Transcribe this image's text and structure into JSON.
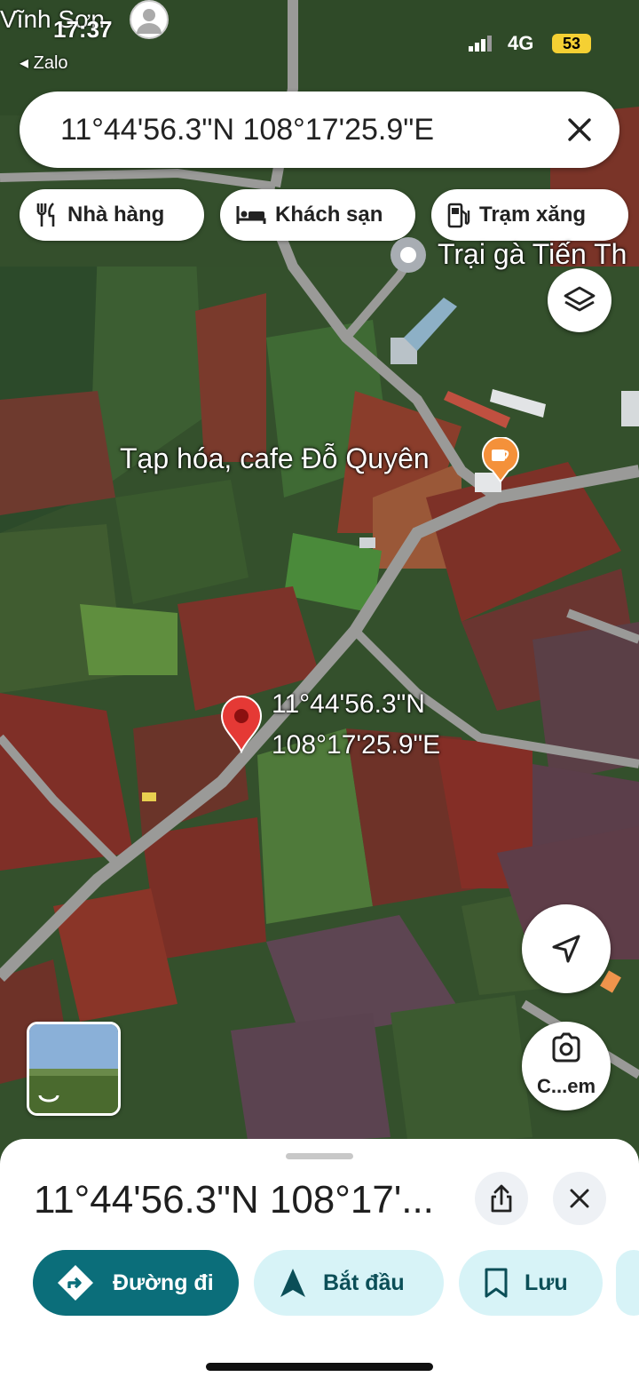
{
  "status": {
    "place_overlay": "Vĩnh Sơn",
    "time": "17:37",
    "back_app": "Zalo",
    "network": "4G",
    "battery": "53"
  },
  "search": {
    "query": "11°44'56.3\"N 108°17'25.9\"E",
    "close_icon": "close-icon"
  },
  "chips": [
    {
      "label": "Nhà hàng",
      "icon": "restaurant-icon"
    },
    {
      "label": "Khách sạn",
      "icon": "hotel-icon"
    },
    {
      "label": "Trạm xăng",
      "icon": "gas-station-icon"
    }
  ],
  "map": {
    "places": [
      {
        "name": "Trại gà Tiến Th",
        "icon": "place-dot-icon"
      },
      {
        "name": "Tạp hóa, cafe Đỗ Quyên",
        "icon": "cafe-icon"
      }
    ],
    "pin": {
      "line1": "11°44'56.3\"N",
      "line2": "108°17'25.9\"E"
    },
    "camera_label": "C...em"
  },
  "sheet": {
    "title": "11°44'56.3\"N 108°17'...",
    "actions": [
      {
        "label": "Đường đi",
        "icon": "directions-icon"
      },
      {
        "label": "Bắt đầu",
        "icon": "navigate-icon"
      },
      {
        "label": "Lưu",
        "icon": "bookmark-icon"
      }
    ]
  },
  "colors": {
    "primary": "#0b6e7a",
    "secondary_bg": "#d7f3f7",
    "pin": "#e53935",
    "cafe": "#f4913a"
  }
}
